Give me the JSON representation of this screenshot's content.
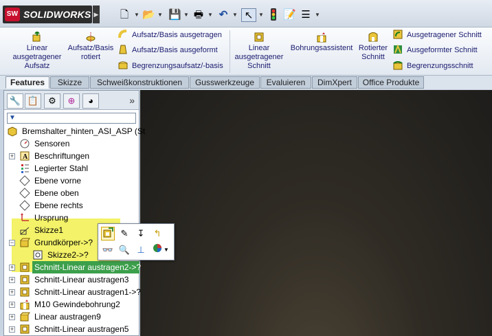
{
  "app": {
    "logo_text": "SOLIDWORKS",
    "logo_badge": "SW"
  },
  "quick_access": [
    {
      "name": "new-document-icon",
      "glyph": "🗋"
    },
    {
      "name": "open-icon",
      "glyph": "📂"
    },
    {
      "name": "save-icon",
      "glyph": "💾"
    },
    {
      "name": "print-icon",
      "glyph": "🖶"
    },
    {
      "name": "undo-icon",
      "glyph": "↶"
    },
    {
      "name": "select-icon",
      "glyph": "↖"
    },
    {
      "name": "rebuild-icon",
      "glyph": "🚦"
    },
    {
      "name": "file-properties-icon",
      "glyph": "📝"
    },
    {
      "name": "options-icon",
      "glyph": "☰"
    }
  ],
  "ribbon": {
    "linear_boss": "Linear ausgetragener Aufsatz",
    "revolved_boss": "Aufsatz/Basis rotiert",
    "swept_boss": "Aufsatz/Basis ausgetragen",
    "lofted_boss": "Aufsatz/Basis ausgeformt",
    "boundary_boss": "Begrenzungsaufsatz/-basis",
    "linear_cut": "Linear ausgetragener Schnitt",
    "hole_wizard": "Bohrungsassistent",
    "revolved_cut": "Rotierter Schnitt",
    "swept_cut": "Ausgetragener Schnitt",
    "lofted_cut": "Ausgeformter Schnitt",
    "boundary_cut": "Begrenzungsschnitt"
  },
  "tabs": [
    "Features",
    "Skizze",
    "Schweißkonstruktionen",
    "Gusswerkzeuge",
    "Evaluieren",
    "DimXpert",
    "Office Produkte"
  ],
  "panel": {
    "more": "»",
    "root": "Bremshalter_hinten_ASI_ASP  (St",
    "items": [
      "Sensoren",
      "Beschriftungen",
      "Legierter Stahl",
      "Ebene vorne",
      "Ebene oben",
      "Ebene rechts",
      "Ursprung",
      "Skizze1",
      "Grundkörper->?",
      "Skizze2->?",
      "Schnitt-Linear austragen2->?",
      "Schnitt-Linear austragen3",
      "Schnitt-Linear austragen1->?",
      "M10 Gewindebohrung2",
      "Linear austragen9",
      "Schnitt-Linear austragen5"
    ]
  },
  "colors": {
    "highlight": "#f3f268",
    "selection": "#3c9f4b",
    "viewport": "#2a2723"
  }
}
